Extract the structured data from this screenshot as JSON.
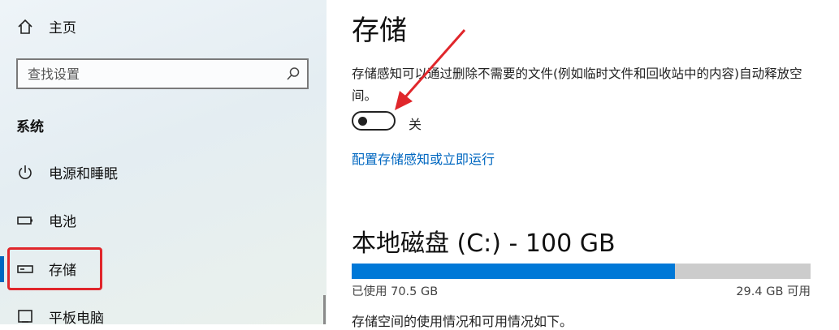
{
  "sidebar": {
    "home": "主页",
    "search_placeholder": "查找设置",
    "section_title": "系统",
    "items": [
      {
        "label": "电源和睡眠",
        "icon": "power-icon"
      },
      {
        "label": "电池",
        "icon": "battery-icon"
      },
      {
        "label": "存储",
        "icon": "storage-icon",
        "selected": true
      },
      {
        "label": "平板电脑",
        "icon": "tablet-icon"
      }
    ]
  },
  "main": {
    "title": "存储",
    "description": "存储感知可以通过删除不需要的文件(例如临时文件和回收站中的内容)自动释放空间。",
    "toggle": {
      "state": "off",
      "label": "关"
    },
    "link": "配置存储感知或立即运行",
    "disk": {
      "title": "本地磁盘 (C:) - 100 GB",
      "used_label": "已使用 70.5 GB",
      "free_label": "29.4 GB 可用",
      "used_fraction": 0.705
    },
    "usage_hint": "存储空间的使用情况和可用情况如下。"
  },
  "colors": {
    "accent": "#0067c0",
    "bar_fill": "#0078d7",
    "bar_track": "#cccccc",
    "annotation": "#e0262b"
  }
}
